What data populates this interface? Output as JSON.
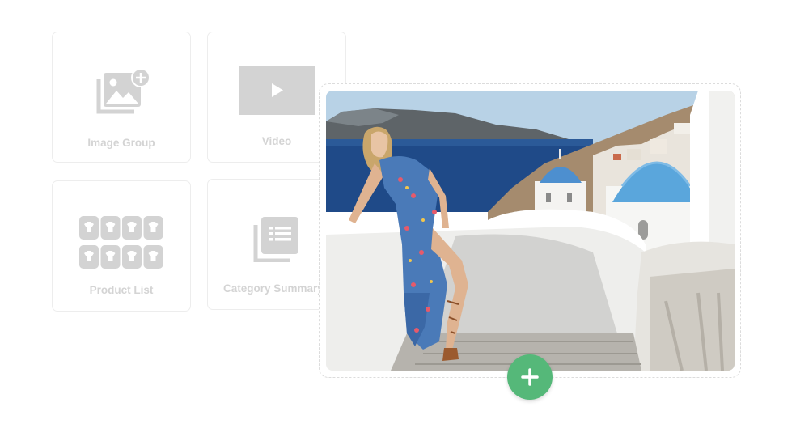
{
  "widgets": [
    {
      "label": "Image Group",
      "icon": "image-group-icon"
    },
    {
      "label": "Video",
      "icon": "video-play-icon"
    },
    {
      "label": "Product List",
      "icon": "product-grid-icon"
    },
    {
      "label": "Category Summary",
      "icon": "category-list-icon"
    }
  ],
  "drop_zone": {
    "image": "photo-woman-blue-floral-dress-santorini",
    "add_icon": "plus-icon"
  },
  "colors": {
    "icon_gray": "#d3d3d3",
    "label_gray": "#d4d4d4",
    "card_border": "#ededed",
    "add_button_green": "#55b879",
    "photo_sky": "#b8d2e6",
    "photo_sea": "#1f4a88",
    "dome_blue": "#5aa6dc"
  }
}
